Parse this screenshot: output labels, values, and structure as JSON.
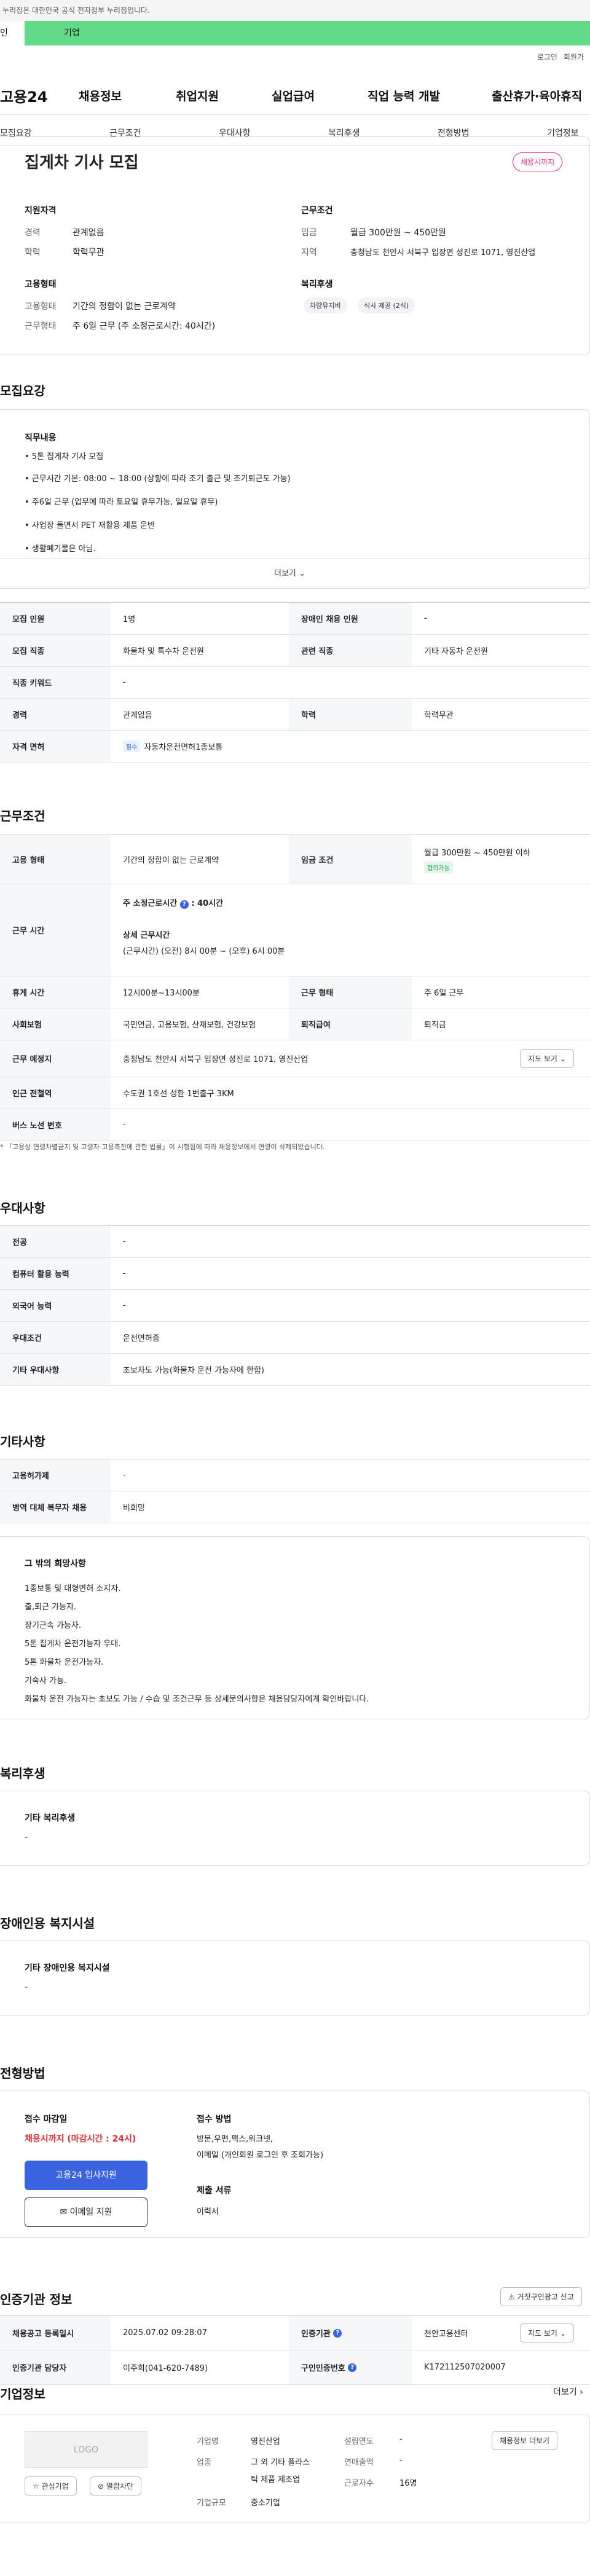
{
  "gov_banner": "이 누리집은 대한민국 공식 전자정부 누리집입니다.",
  "gov_banner_visible": "누리집은 대한민국 공식 전자정부 누리집입니다.",
  "member_tabs": [
    "인",
    "기업"
  ],
  "util": {
    "login": "로그인",
    "join": "회원가"
  },
  "logo": "고용24",
  "gnb": [
    "채용정보",
    "취업지원",
    "실업급여",
    "직업 능력 개발",
    "출산휴가·육아휴직"
  ],
  "anchors": [
    "모집요강",
    "근무조건",
    "우대사항",
    "복리후생",
    "전형방법",
    "기업정보"
  ],
  "summary": {
    "title": "집게차 기사 모집",
    "badge": "채용시까지",
    "qual_title": "지원자격",
    "career_k": "경력",
    "career_v": "관계없음",
    "edu_k": "학력",
    "edu_v": "학력무관",
    "cond_title": "근무조건",
    "wage_k": "임금",
    "wage_v": "월급 300만원 ~ 450만원",
    "loc_k": "지역",
    "loc_v": "충청남도 천안시 서북구 입장면 성진로 1071, 영진산업",
    "emp_title": "고용형태",
    "emptype_k": "고용형태",
    "emptype_v": "기간의 정함이 없는 근로계약",
    "worktype_k": "근무형태",
    "worktype_v": "주 6일 근무 (주 소정근로시간: 40시간)",
    "welfare_title": "복리후생",
    "welfare_chips": [
      "차량유지비",
      "식사 제공 (2식)"
    ]
  },
  "recruit": {
    "section": "모집요강",
    "duty_title": "직무내용",
    "duties": [
      "• 5톤 집게차 기사 모집",
      "• 근무시간 기본: 08:00 ~ 18:00 (상황에 따라 조기 출근 및 조기퇴근도 가능)",
      "• 주6일 근무 (업무에 따라 토요일 휴무가능, 일요일 휴무)",
      "• 사업장 돌면서 PET 재활용 제품 운반",
      "• 생활폐기물은 아님."
    ],
    "more": "더보기",
    "rows": [
      {
        "k1": "모집 인원",
        "v1": "1명",
        "k2": "장애인 채용 인원",
        "v2": "-"
      },
      {
        "k1": "모집 직종",
        "v1": "화물차 및 특수차 운전원",
        "k2": "관련 직종",
        "v2": "기타 자동차 운전원"
      },
      {
        "k1": "직종 키워드",
        "v1": "-"
      },
      {
        "k1": "경력",
        "v1": "관계없음",
        "k2": "학력",
        "v2": "학력무관"
      },
      {
        "k1": "자격 면허",
        "tag": "필수",
        "v1": "자동차운전면허1종보통"
      }
    ]
  },
  "work": {
    "section": "근무조건",
    "emptype_k": "고용 형태",
    "emptype_v": "기간의 정함이 없는 근로계약",
    "wage_k": "임금 조건",
    "wage_v": "월급 300만원 ~ 450만원 이하",
    "wage_tag": "협의가능",
    "time_k": "근무 시간",
    "time_main": "주 소정근로시간",
    "time_main_v": ": 40시간",
    "time_detail_title": "상세 근무시간",
    "time_detail_v": "(근무시간) (오전) 8시 00분 ~ (오후) 6시 00분",
    "rest_k": "휴게 시간",
    "rest_v": "12시00분~13시00분",
    "form_k": "근무 형태",
    "form_v": "주 6일 근무",
    "ins_k": "사회보험",
    "ins_v": "국민연금, 고용보험, 산재보험, 건강보험",
    "ret_k": "퇴직급여",
    "ret_v": "퇴직금",
    "place_k": "근무 예정지",
    "place_v": "충청남도 천안시 서북구 입장면 성진로 1071, 영진산업",
    "map_btn": "지도 보기",
    "subway_k": "인근 전철역",
    "subway_v": "수도권 1호선 성환 1번출구 3KM",
    "bus_k": "버스 노선 번호",
    "bus_v": "-",
    "note": "* 「고용상 연령차별금지 및 고령자 고용촉진에 관한 법률」이 시행됨에 따라 채용정보에서 연령이 삭제되었습니다."
  },
  "pref": {
    "section": "우대사항",
    "rows": [
      {
        "k": "전공",
        "v": "-"
      },
      {
        "k": "컴퓨터 활용 능력",
        "v": "-"
      },
      {
        "k": "외국어 능력",
        "v": "-"
      },
      {
        "k": "우대조건",
        "v": "운전면허증"
      },
      {
        "k": "기타 우대사항",
        "v": "초보자도 가능(화물차 운전 가능자에 한함)"
      }
    ]
  },
  "etc": {
    "section": "기타사항",
    "rows": [
      {
        "k": "고용허가제",
        "v": "-"
      },
      {
        "k": "병역 대체 복무자 채용",
        "v": "비희망"
      }
    ],
    "wish_title": "그 밖의 희망사항",
    "wish_lines": [
      "1종보통 및 대형면허 소지자.",
      "출,퇴근 가능자.",
      "장기근속 가능자.",
      "5톤 집게차 운전가능자 우대.",
      "5톤 화물차 운전가능자.",
      "기숙사 가능.",
      "화물차 운전 가능자는 초보도 가능 / 수습 및 조건근무 등 상세문의사항은 채용담당자에게 확인바랍니다."
    ]
  },
  "welfare": {
    "section": "복리후생",
    "box_title": "기타 복리후생",
    "box_v": "-"
  },
  "disabled": {
    "section": "장애인용 복지시설",
    "box_title": "기타 장애인용 복지시설",
    "box_v": "-"
  },
  "process": {
    "section": "전형방법",
    "deadline_k": "접수 마감일",
    "deadline_v": "채용시까지 (마감시간 : 24시)",
    "apply_btn": "고용24 입사지원",
    "email_btn": "이메일 지원",
    "method_k": "접수 방법",
    "method_v1": "방문,우편,팩스,워크넷,",
    "method_v2": "이메일 (개인회원 로그인 후 조회가능)",
    "docs_k": "제출 서류",
    "docs_v": "이력서"
  },
  "agency": {
    "section": "인증기관 정보",
    "report_btn": "거짓구인광고 신고",
    "reg_k": "채용공고 등록일시",
    "reg_v": "2025.07.02 09:28:07",
    "org_k": "인증기관",
    "org_v": "천안고용센터",
    "map_btn": "지도 보기",
    "mgr_k": "인증기관 담당자",
    "mgr_v": "이주희(041-620-7489)",
    "no_k": "구인인증번호",
    "no_v": "K172112507020007"
  },
  "company": {
    "section": "기업정보",
    "more": "더보기",
    "logo": "LOGO",
    "fav_btn": "관심기업",
    "block_btn": "열람차단",
    "name_k": "기업명",
    "name_v": "영진산업",
    "ind_k": "업종",
    "ind_v1": "그 외 기타 플라스",
    "ind_v2": "틱 제품 제조업",
    "size_k": "기업규모",
    "size_v": "중소기업",
    "est_k": "설립연도",
    "est_v": "-",
    "rev_k": "연매출액",
    "rev_v": "-",
    "emp_k": "근로자수",
    "emp_v": "16명",
    "jobs_btn": "채용정보 더보기"
  }
}
